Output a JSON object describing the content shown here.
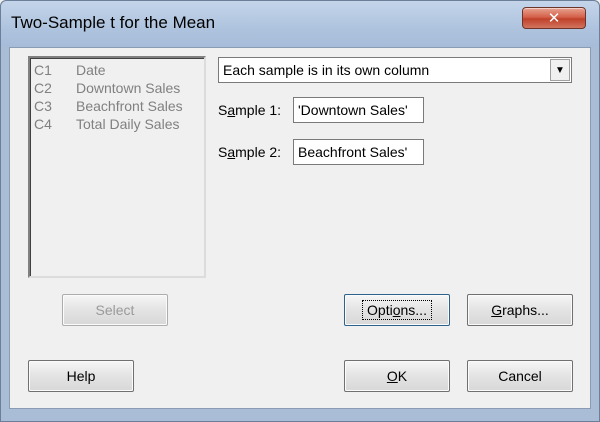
{
  "window": {
    "title": "Two-Sample t for the Mean",
    "close_glyph": "✕"
  },
  "variables": [
    {
      "id": "C1",
      "name": "Date"
    },
    {
      "id": "C2",
      "name": "Downtown Sales"
    },
    {
      "id": "C3",
      "name": "Beachfront Sales"
    },
    {
      "id": "C4",
      "name": "Total Daily Sales"
    }
  ],
  "data_layout": {
    "selected": "Each sample is in its own column",
    "arrow_glyph": "▼"
  },
  "sample1": {
    "label_prefix": "S",
    "label_underline": "a",
    "label_suffix": "mple 1:",
    "value": "'Downtown Sales'"
  },
  "sample2": {
    "label_prefix": "S",
    "label_underline": "a",
    "label_suffix": "mple 2:",
    "value": "Beachfront Sales'"
  },
  "buttons": {
    "select": "Select",
    "options_prefix": "Opti",
    "options_underline": "o",
    "options_suffix": "ns...",
    "graphs_underline": "G",
    "graphs_suffix": "raphs...",
    "help": "Help",
    "ok_underline": "O",
    "ok_suffix": "K",
    "cancel": "Cancel"
  }
}
